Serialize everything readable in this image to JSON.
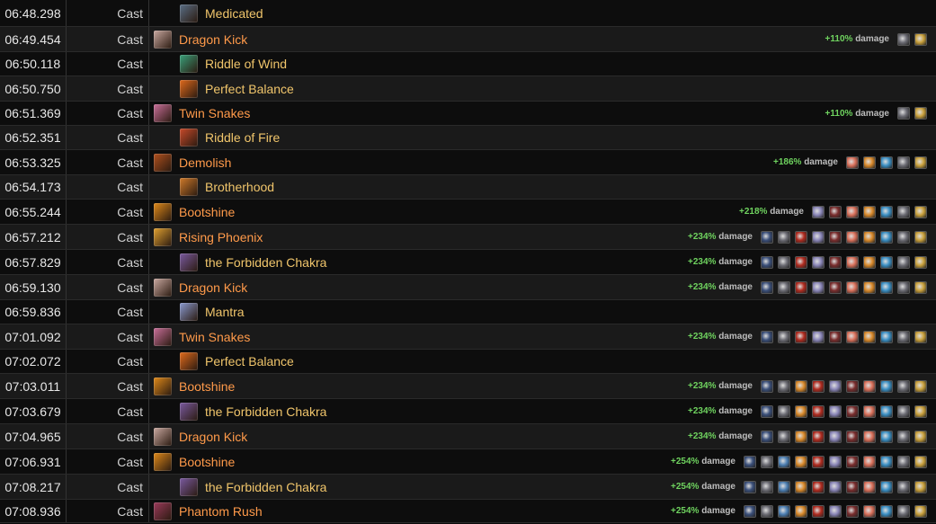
{
  "buff_label": "damage",
  "icon_colors": {
    "blue": "#3a4f7a",
    "gray": "#6d6d75",
    "orange": "#d9892a",
    "red": "#b02b1f",
    "lavender": "#8a86b8",
    "salmon": "#d9705a",
    "teal": "#3a8fc4",
    "gold": "#c9a03b",
    "maroon": "#7a2d2d",
    "sky": "#4c7fb3"
  },
  "ability_icon_colors": {
    "medicated": "#5a6f86",
    "dragon-kick": "#c9a8a0",
    "riddle-of-wind": "#3aa07a",
    "perfect-balance": "#e06a1c",
    "twin-snakes": "#c96f9a",
    "riddle-of-fire": "#c84a2a",
    "demolish": "#b0501e",
    "brotherhood": "#cf7a2a",
    "bootshine": "#e08a1a",
    "rising-phoenix": "#e0a030",
    "forbidden-chakra": "#7a5aa0",
    "mantra": "#8a9ad0",
    "phantom-rush": "#9a3a5a"
  },
  "rows": [
    {
      "time": "06:48.298",
      "type": "Cast",
      "ability": "Medicated",
      "icon": "medicated",
      "ogcd": true,
      "bonus": "",
      "buffs": []
    },
    {
      "time": "06:49.454",
      "type": "Cast",
      "ability": "Dragon Kick",
      "icon": "dragon-kick",
      "ogcd": false,
      "bonus": "+110%",
      "buffs": [
        "gray",
        "gold"
      ]
    },
    {
      "time": "06:50.118",
      "type": "Cast",
      "ability": "Riddle of Wind",
      "icon": "riddle-of-wind",
      "ogcd": true,
      "bonus": "",
      "buffs": []
    },
    {
      "time": "06:50.750",
      "type": "Cast",
      "ability": "Perfect Balance",
      "icon": "perfect-balance",
      "ogcd": true,
      "bonus": "",
      "buffs": []
    },
    {
      "time": "06:51.369",
      "type": "Cast",
      "ability": "Twin Snakes",
      "icon": "twin-snakes",
      "ogcd": false,
      "bonus": "+110%",
      "buffs": [
        "gray",
        "gold"
      ]
    },
    {
      "time": "06:52.351",
      "type": "Cast",
      "ability": "Riddle of Fire",
      "icon": "riddle-of-fire",
      "ogcd": true,
      "bonus": "",
      "buffs": []
    },
    {
      "time": "06:53.325",
      "type": "Cast",
      "ability": "Demolish",
      "icon": "demolish",
      "ogcd": false,
      "bonus": "+186%",
      "buffs": [
        "salmon",
        "orange",
        "teal",
        "gray",
        "gold"
      ]
    },
    {
      "time": "06:54.173",
      "type": "Cast",
      "ability": "Brotherhood",
      "icon": "brotherhood",
      "ogcd": true,
      "bonus": "",
      "buffs": []
    },
    {
      "time": "06:55.244",
      "type": "Cast",
      "ability": "Bootshine",
      "icon": "bootshine",
      "ogcd": false,
      "bonus": "+218%",
      "buffs": [
        "lavender",
        "maroon",
        "salmon",
        "orange",
        "teal",
        "gray",
        "gold"
      ]
    },
    {
      "time": "06:57.212",
      "type": "Cast",
      "ability": "Rising Phoenix",
      "icon": "rising-phoenix",
      "ogcd": false,
      "bonus": "+234%",
      "buffs": [
        "blue",
        "gray",
        "red",
        "lavender",
        "maroon",
        "salmon",
        "orange",
        "teal",
        "gray",
        "gold"
      ]
    },
    {
      "time": "06:57.829",
      "type": "Cast",
      "ability": "the Forbidden Chakra",
      "icon": "forbidden-chakra",
      "ogcd": true,
      "bonus": "+234%",
      "buffs": [
        "blue",
        "gray",
        "red",
        "lavender",
        "maroon",
        "salmon",
        "orange",
        "teal",
        "gray",
        "gold"
      ]
    },
    {
      "time": "06:59.130",
      "type": "Cast",
      "ability": "Dragon Kick",
      "icon": "dragon-kick",
      "ogcd": false,
      "bonus": "+234%",
      "buffs": [
        "blue",
        "gray",
        "red",
        "lavender",
        "maroon",
        "salmon",
        "orange",
        "teal",
        "gray",
        "gold"
      ]
    },
    {
      "time": "06:59.836",
      "type": "Cast",
      "ability": "Mantra",
      "icon": "mantra",
      "ogcd": true,
      "bonus": "",
      "buffs": []
    },
    {
      "time": "07:01.092",
      "type": "Cast",
      "ability": "Twin Snakes",
      "icon": "twin-snakes",
      "ogcd": false,
      "bonus": "+234%",
      "buffs": [
        "blue",
        "gray",
        "red",
        "lavender",
        "maroon",
        "salmon",
        "orange",
        "teal",
        "gray",
        "gold"
      ]
    },
    {
      "time": "07:02.072",
      "type": "Cast",
      "ability": "Perfect Balance",
      "icon": "perfect-balance",
      "ogcd": true,
      "bonus": "",
      "buffs": []
    },
    {
      "time": "07:03.011",
      "type": "Cast",
      "ability": "Bootshine",
      "icon": "bootshine",
      "ogcd": false,
      "bonus": "+234%",
      "buffs": [
        "blue",
        "gray",
        "orange",
        "red",
        "lavender",
        "maroon",
        "salmon",
        "teal",
        "gray",
        "gold"
      ]
    },
    {
      "time": "07:03.679",
      "type": "Cast",
      "ability": "the Forbidden Chakra",
      "icon": "forbidden-chakra",
      "ogcd": true,
      "bonus": "+234%",
      "buffs": [
        "blue",
        "gray",
        "orange",
        "red",
        "lavender",
        "maroon",
        "salmon",
        "teal",
        "gray",
        "gold"
      ]
    },
    {
      "time": "07:04.965",
      "type": "Cast",
      "ability": "Dragon Kick",
      "icon": "dragon-kick",
      "ogcd": false,
      "bonus": "+234%",
      "buffs": [
        "blue",
        "gray",
        "orange",
        "red",
        "lavender",
        "maroon",
        "salmon",
        "teal",
        "gray",
        "gold"
      ]
    },
    {
      "time": "07:06.931",
      "type": "Cast",
      "ability": "Bootshine",
      "icon": "bootshine",
      "ogcd": false,
      "bonus": "+254%",
      "buffs": [
        "blue",
        "gray",
        "sky",
        "orange",
        "red",
        "lavender",
        "maroon",
        "salmon",
        "teal",
        "gray",
        "gold"
      ]
    },
    {
      "time": "07:08.217",
      "type": "Cast",
      "ability": "the Forbidden Chakra",
      "icon": "forbidden-chakra",
      "ogcd": true,
      "bonus": "+254%",
      "buffs": [
        "blue",
        "gray",
        "sky",
        "orange",
        "red",
        "lavender",
        "maroon",
        "salmon",
        "teal",
        "gray",
        "gold"
      ]
    },
    {
      "time": "07:08.936",
      "type": "Cast",
      "ability": "Phantom Rush",
      "icon": "phantom-rush",
      "ogcd": false,
      "bonus": "+254%",
      "buffs": [
        "blue",
        "gray",
        "sky",
        "orange",
        "red",
        "lavender",
        "maroon",
        "salmon",
        "teal",
        "gray",
        "gold"
      ]
    }
  ]
}
